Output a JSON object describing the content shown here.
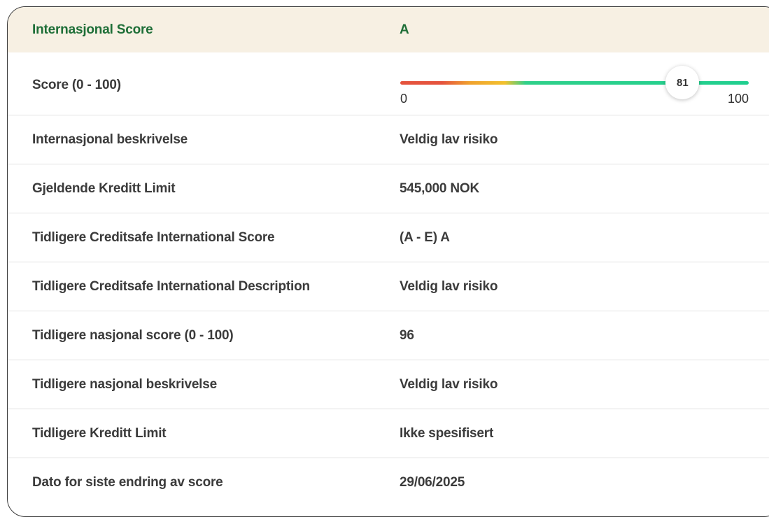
{
  "header": {
    "label": "Internasjonal Score",
    "value": "A"
  },
  "score": {
    "label": "Score (0 - 100)",
    "value": 81,
    "value_text": "81",
    "min": "0",
    "max": "100",
    "min_value": 0,
    "max_value": 100,
    "gradient_colors": [
      "#e5533d",
      "#f0a22e",
      "#f2c12e",
      "#20cf8f"
    ]
  },
  "rows": [
    {
      "label": "Internasjonal beskrivelse",
      "value": "Veldig lav risiko"
    },
    {
      "label": "Gjeldende Kreditt Limit",
      "value": "545,000 NOK"
    },
    {
      "label": "Tidligere Creditsafe International Score",
      "value": "(A - E) A"
    },
    {
      "label": "Tidligere Creditsafe International Description",
      "value": "Veldig lav risiko"
    },
    {
      "label": "Tidligere nasjonal score (0 - 100)",
      "value": "96"
    },
    {
      "label": "Tidligere nasjonal beskrivelse",
      "value": "Veldig lav risiko"
    },
    {
      "label": "Tidligere Kreditt Limit",
      "value": "Ikke spesifisert"
    },
    {
      "label": "Dato for siste endring av score",
      "value": "29/06/2025"
    }
  ],
  "colors": {
    "header_bg": "#f7f0e3",
    "header_text": "#1e6e37",
    "text": "#3b3b3b",
    "border": "#3a3a3a",
    "divider": "#e2e2e2"
  }
}
